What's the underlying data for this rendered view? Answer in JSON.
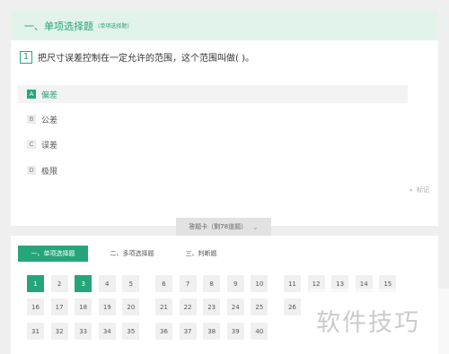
{
  "section": {
    "title": "一、单项选择题",
    "subtitle": "(单项选择题)"
  },
  "question": {
    "number": "1",
    "text": "把尺寸误差控制在一定允许的范围，这个范围叫做( )。"
  },
  "options": [
    {
      "letter": "A",
      "text": "偏差",
      "selected": true
    },
    {
      "letter": "B",
      "text": "公差",
      "selected": false
    },
    {
      "letter": "C",
      "text": "误差",
      "selected": false
    },
    {
      "letter": "D",
      "text": "极限",
      "selected": false
    }
  ],
  "mark_label": "标记",
  "answer_card": {
    "label": "答题卡（剩78道题）"
  },
  "tabs": [
    {
      "label": "一、单项选择题",
      "active": true
    },
    {
      "label": "二、多项选择题",
      "active": false
    },
    {
      "label": "三、判断题",
      "active": false
    }
  ],
  "grid": [
    [
      "1",
      "2",
      "3",
      "4",
      "5",
      "",
      "6",
      "7",
      "8",
      "9",
      "10",
      "",
      "11",
      "12",
      "13",
      "14",
      "15"
    ],
    [
      "16",
      "17",
      "18",
      "19",
      "20",
      "",
      "21",
      "22",
      "23",
      "24",
      "25",
      "",
      "26"
    ],
    [
      "31",
      "32",
      "33",
      "34",
      "35",
      "",
      "36",
      "37",
      "38",
      "39",
      "40"
    ]
  ],
  "answered": [
    "1",
    "3"
  ],
  "watermark": "软件技巧",
  "colors": {
    "accent": "#27a57a",
    "header_bg": "#e2f3ea"
  }
}
